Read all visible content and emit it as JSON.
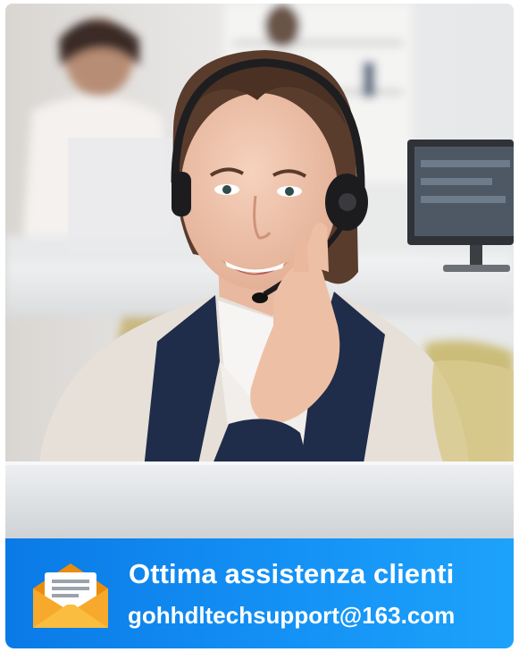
{
  "banner": {
    "title": "Ottima assistenza clienti",
    "email": "gohhdltechsupport@163.com",
    "icon": "envelope-letter-icon"
  },
  "photo": {
    "subject": "customer-support-agent-photo"
  },
  "colors": {
    "banner_start": "#0a7ae6",
    "banner_end": "#1da2fb",
    "envelope": "#f5a623",
    "text": "#ffffff"
  }
}
